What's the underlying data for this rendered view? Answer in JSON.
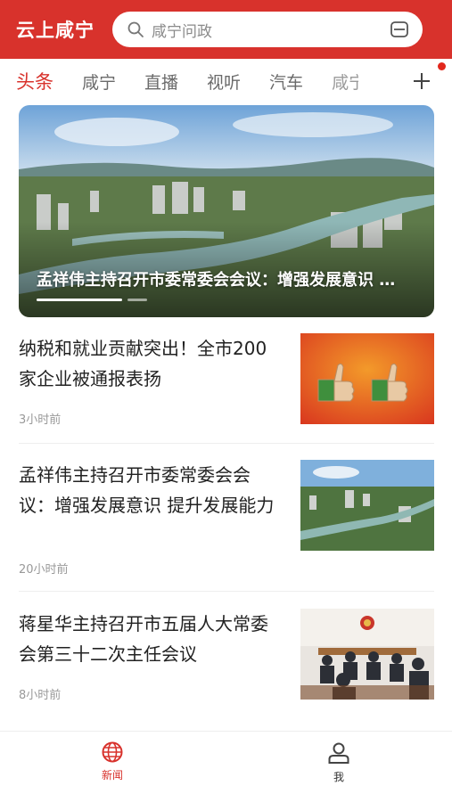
{
  "header": {
    "brand": "云上咸宁",
    "search_placeholder": "咸宁问政",
    "search_icon": "search-icon",
    "scan_icon": "scan-icon",
    "color": "#d8322c"
  },
  "tabs": [
    {
      "label": "头条",
      "active": true
    },
    {
      "label": "咸宁",
      "active": false
    },
    {
      "label": "直播",
      "active": false
    },
    {
      "label": "视听",
      "active": false
    },
    {
      "label": "汽车",
      "active": false
    },
    {
      "label": "咸宁",
      "active": false
    }
  ],
  "hero": {
    "title": "孟祥伟主持召开市委常委会会议：增强发展意识 提升发展能力"
  },
  "news": [
    {
      "title": "纳税和就业贡献突出！全市200家企业被通报表扬",
      "time": "3小时前"
    },
    {
      "title": "孟祥伟主持召开市委常委会会议：增强发展意识 提升发展能力",
      "time": "20小时前"
    },
    {
      "title": "蒋星华主持召开市五届人大常委会第三十二次主任会议",
      "time": "8小时前"
    }
  ],
  "bottom_nav": {
    "news_label": "新闻",
    "me_label": "我"
  }
}
